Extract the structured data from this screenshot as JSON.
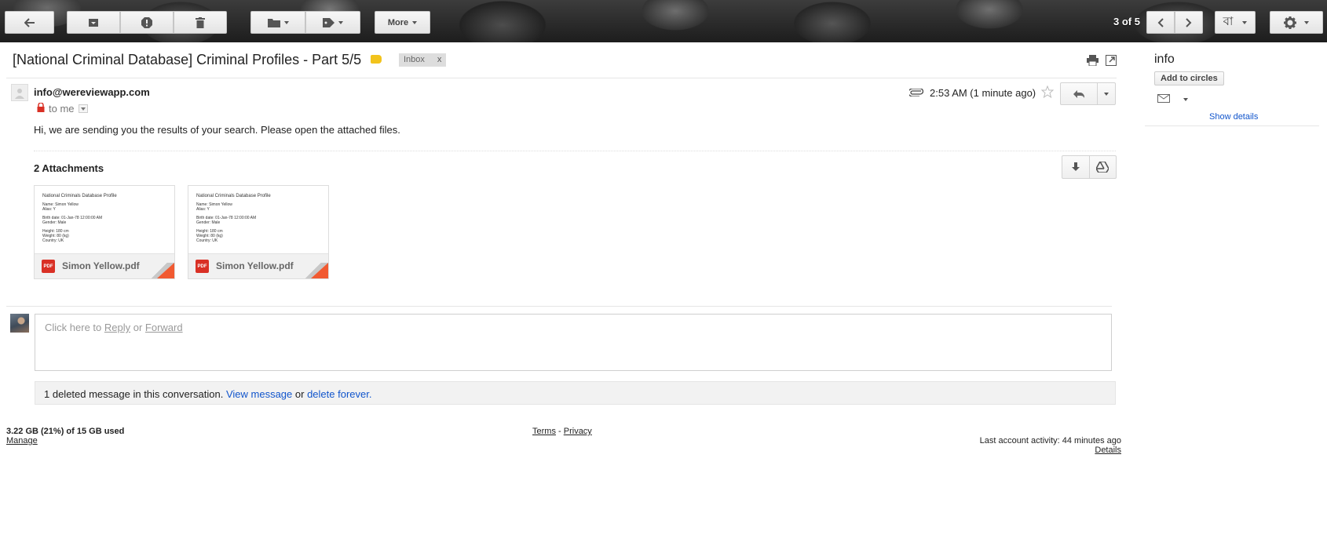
{
  "toolbar": {
    "more_label": "More",
    "pager_text": "3 of 5",
    "input_tool_label": "বা",
    "icons": [
      "back-arrow-icon",
      "archive-icon",
      "report-spam-icon",
      "delete-icon",
      "move-to-folder-icon",
      "labels-icon",
      "chevron-left-icon",
      "chevron-right-icon",
      "gear-icon"
    ]
  },
  "thread": {
    "subject": "[National Criminal Database] Criminal Profiles - Part 5/5",
    "label_inbox": "Inbox",
    "label_remove": "x"
  },
  "message": {
    "sender": "info@wereviewapp.com",
    "to": "to me",
    "timestamp": "2:53 AM (1 minute ago)",
    "body": "Hi, we are sending you the results of your search. Please open the attached files."
  },
  "attachments": {
    "title": "2 Attachments",
    "items": [
      {
        "filename": "Simon Yellow.pdf",
        "badge": "PDF",
        "preview": {
          "title": "National Criminals Database Profile",
          "name": "Name: Simon Yellow",
          "alias": "Alias: Y",
          "birth": "Birth date: 01-Jan-78 12:00:00 AM",
          "gender": "Gender: Male",
          "height": "Height: 180 cm",
          "weight": "Weight: 80 (kg)",
          "country": "Country: UK"
        }
      },
      {
        "filename": "Simon Yellow.pdf",
        "badge": "PDF",
        "preview": {
          "title": "National Criminals Database Profile",
          "name": "Name: Simon Yellow",
          "alias": "Alias: Y",
          "birth": "Birth date: 01-Jan-78 12:00:00 AM",
          "gender": "Gender: Male",
          "height": "Height: 180 cm",
          "weight": "Weight: 80 (kg)",
          "country": "Country: UK"
        }
      }
    ]
  },
  "reply": {
    "prefix": "Click here to ",
    "reply_link": "Reply",
    "middle": " or ",
    "forward_link": "Forward"
  },
  "deleted": {
    "text": "1 deleted message in this conversation. ",
    "view_link": "View message",
    "or_text": " or ",
    "delete_link": "delete forever."
  },
  "footer": {
    "storage": "3.22 GB (21%) of 15 GB used",
    "manage": "Manage",
    "terms": "Terms",
    "separator": "-",
    "privacy": "Privacy",
    "activity": "Last account activity: 44 minutes ago",
    "details": "Details"
  },
  "side_panel": {
    "name": "info",
    "add_to_circles": "Add to circles",
    "show_details": "Show details"
  },
  "colors": {
    "link": "#1155cc",
    "label_yellow": "#f2c31c",
    "pdf_red": "#d93025",
    "corner_orange": "#f15a31"
  }
}
